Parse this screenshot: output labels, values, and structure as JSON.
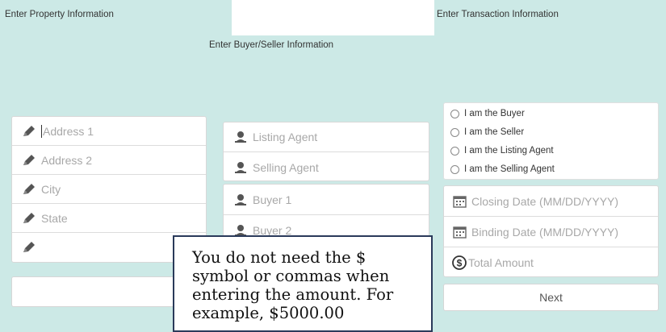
{
  "property": {
    "header": "Enter Property Information",
    "fields": [
      {
        "placeholder": "Address 1"
      },
      {
        "placeholder": "Address 2"
      },
      {
        "placeholder": "City"
      },
      {
        "placeholder": "State"
      },
      {
        "placeholder": ""
      }
    ]
  },
  "buyer_seller": {
    "header": "Enter Buyer/Seller Information",
    "agents": [
      {
        "placeholder": "Listing Agent"
      },
      {
        "placeholder": "Selling Agent"
      }
    ],
    "buyers": [
      {
        "placeholder": "Buyer 1"
      },
      {
        "placeholder": "Buyer 2"
      }
    ]
  },
  "transaction": {
    "header": "Enter Transaction Information",
    "roles": [
      "I am the Buyer",
      "I am the Seller",
      "I am the Listing Agent",
      "I am the Selling Agent"
    ],
    "fields": [
      {
        "placeholder": "Closing Date (MM/DD/YYYY)"
      },
      {
        "placeholder": "Binding Date (MM/DD/YYYY)"
      },
      {
        "placeholder": "Total Amount"
      }
    ],
    "next_label": "Next"
  },
  "callout": {
    "text": "You do not need the $ symbol or commas when entering the amount.  For example, $5000.00"
  },
  "colors": {
    "background": "#cce9e6",
    "callout_border": "#2a3a5a"
  },
  "icons": {
    "property": "pencil-icon",
    "person": "person-icon",
    "date": "calendar-icon",
    "amount": "dollar-icon",
    "radio": "radio-button"
  }
}
